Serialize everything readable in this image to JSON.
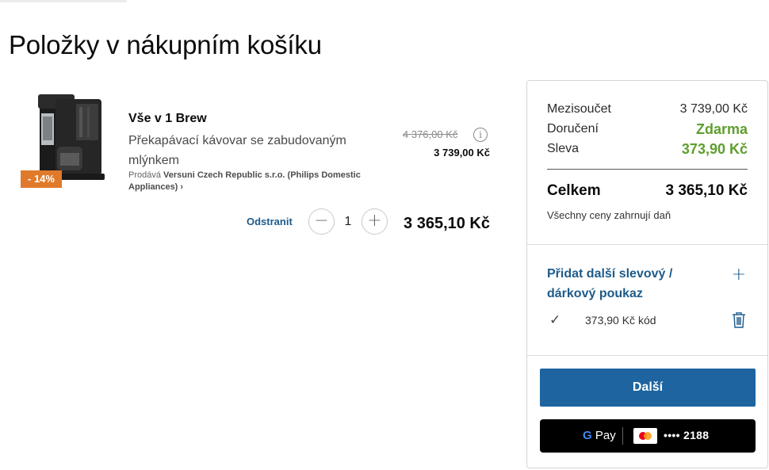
{
  "page": {
    "title": "Položky v nákupním košíku"
  },
  "cart_item": {
    "discount_badge": "- 14%",
    "name": "Vše v 1 Brew",
    "description": "Překapávací kávovar se zabudovaným mlýnkem",
    "seller_prefix": "Prodává",
    "seller_name": "Versuni Czech Republic s.r.o. (Philips Domestic Appliances) ›",
    "price_original": "4 376,00  Kč",
    "price_current": "3 739,00  Kč",
    "remove_label": "Odstranit",
    "quantity": "1",
    "line_total": "3 365,10  Kč",
    "icons": {
      "info": "info-icon",
      "minus": "minus-icon",
      "plus": "plus-icon"
    }
  },
  "summary": {
    "subtotal_label": "Mezisoučet",
    "subtotal_value": "3 739,00  Kč",
    "delivery_label": "Doručení",
    "delivery_value": "Zdarma",
    "discount_label": "Sleva",
    "discount_value": "373,90  Kč",
    "total_label": "Celkem",
    "total_value": "3 365,10  Kč",
    "tax_note": "Všechny ceny zahrnují daň",
    "voucher_title": "Přidat další slevový / dárkový poukaz",
    "applied_voucher": "373,90 Kč  kód",
    "next_button": "Další",
    "gpay_label": "Pay",
    "gpay_g": "G",
    "card_digits": "•••• 2188"
  },
  "colors": {
    "accent_blue": "#1d64a0",
    "link_blue": "#1d5b8b",
    "green": "#5f9e2f",
    "badge_orange": "#e07a2a"
  }
}
